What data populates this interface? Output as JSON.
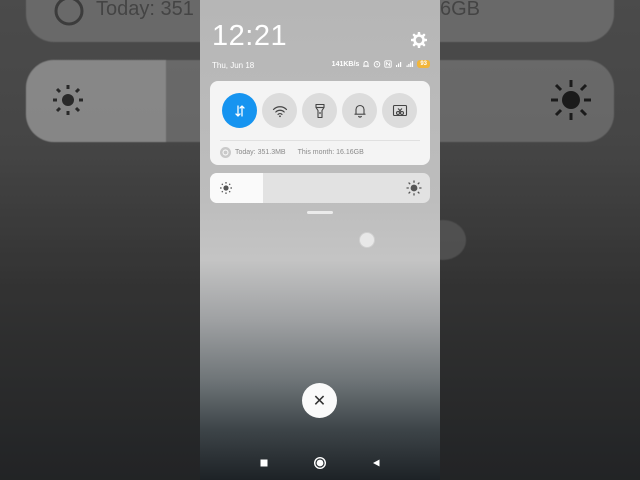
{
  "background": {
    "usage_text": "Today: 351",
    "usage_tail": "6GB"
  },
  "status_bar": {
    "time": "12:21",
    "date": "Thu, Jun 18",
    "net_speed": "141KB/s",
    "battery": "93"
  },
  "quick_settings": {
    "tiles": [
      {
        "name": "mobile-data",
        "icon": "data-transfer-arrows-icon",
        "active": true
      },
      {
        "name": "wifi",
        "icon": "wifi-icon",
        "active": false
      },
      {
        "name": "flashlight",
        "icon": "flashlight-icon",
        "active": false
      },
      {
        "name": "sound",
        "icon": "bell-icon",
        "active": false
      },
      {
        "name": "screenshot",
        "icon": "scissors-screenshot-icon",
        "active": false
      }
    ],
    "usage_today": "Today: 351.3MB",
    "usage_month": "This month: 16.16GB"
  },
  "brightness": {
    "level": 0.24
  },
  "colors": {
    "accent": "#1694f0",
    "battery": "#f1b53a"
  },
  "close_label": "✕"
}
